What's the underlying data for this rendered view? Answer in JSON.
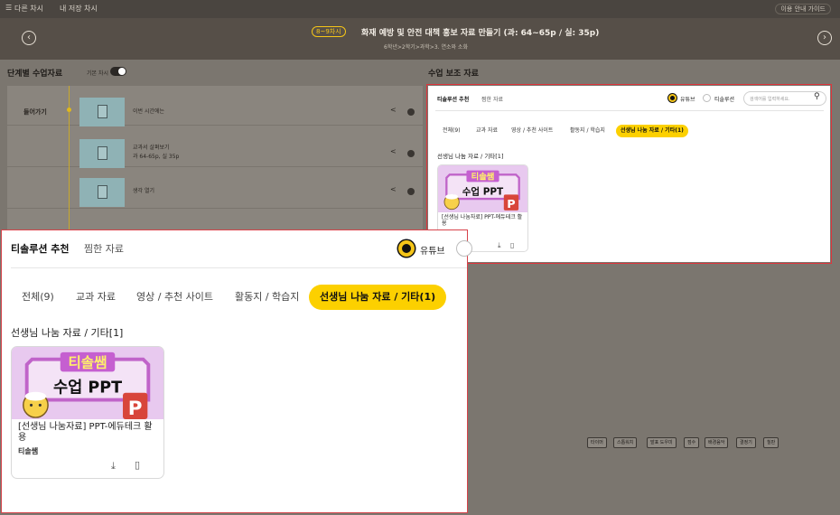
{
  "topbar": {
    "menu_icon": "hamburger-icon",
    "tab1": "다른 차시",
    "tab2": "내 저장 차시",
    "guide": "이용 안내 가이드"
  },
  "lesson": {
    "badge": "8~9차시",
    "title": "화재 예방 및 안전 대책 홍보 자료 만들기 (과: 64~65p / 실: 35p)",
    "subtitle": "6학년>2학기>과학>3. 연소와 소화"
  },
  "left_section": {
    "title": "단계별 수업자료",
    "toggle_label": "기본 차시",
    "step": "들어가기",
    "rows": [
      {
        "text": "이번 시간에는",
        "text2": ""
      },
      {
        "text": "교과서 살펴보기",
        "text2": "과 64-65p, 실 35p"
      },
      {
        "text": "생각 열기",
        "text2": ""
      }
    ]
  },
  "right_section": {
    "title": "수업 보조 자료"
  },
  "tools": [
    "타이머",
    "스톱워치",
    "발표 도우미",
    "점수",
    "배경음악",
    "결정기",
    "칠판"
  ],
  "panel": {
    "tab_recommend": "티솔루션 추천",
    "tab_saved": "찜한 자료",
    "radio_youtube": "유튜브",
    "radio_tsol": "티솔루션",
    "search_placeholder": "검색어를 입력하세요.",
    "chips": [
      "전체(9)",
      "교과 자료",
      "영상 / 추천 사이트",
      "활동지 / 학습지",
      "선생님 나눔 자료 / 기타(1)"
    ],
    "active_chip_index": 4,
    "count_label": "선생님 나눔 자료 / 기타[1]",
    "card": {
      "banner_top": "티솔쌤",
      "banner_main": "수업 PPT",
      "ppt_letter": "P",
      "title": "[선생님 나눔자료] PPT-에듀테크 활용",
      "author": "티솔쌤",
      "download_icon": "download-icon",
      "bookmark_icon": "bookmark-icon"
    }
  },
  "colors": {
    "accent": "#fcd000",
    "highlight_border": "#e0333a",
    "dark_bar": "#4a4540"
  }
}
